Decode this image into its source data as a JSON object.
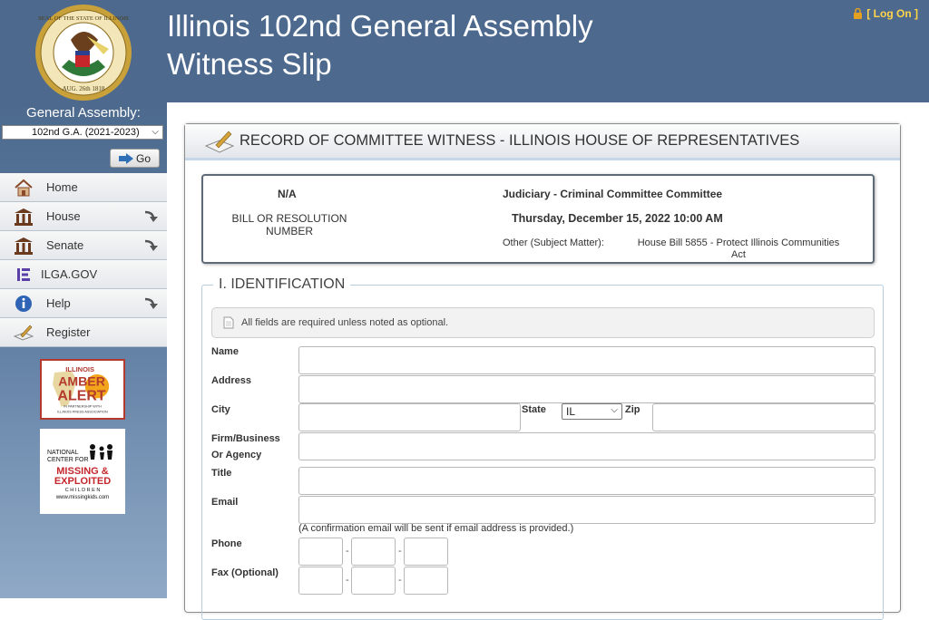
{
  "header": {
    "title_line1": "Illinois 102nd General Assembly",
    "title_line2": "Witness Slip",
    "logon": "[ Log On ]",
    "seal_text_top": "SEAL OF THE STATE OF ILLINOIS",
    "seal_text_bottom": "AUG. 26th 1818"
  },
  "sidebar": {
    "ga_label": "General Assembly:",
    "ga_selected": "102nd G.A. (2021-2023)",
    "go_label": "Go",
    "nav": [
      {
        "label": "Home",
        "icon": "house-icon"
      },
      {
        "label": "House",
        "icon": "capitol-icon"
      },
      {
        "label": "Senate",
        "icon": "capitol-icon"
      },
      {
        "label": "ILGA.GOV",
        "icon": "ilga-logo-icon"
      },
      {
        "label": "Help",
        "icon": "info-icon"
      },
      {
        "label": "Register",
        "icon": "pen-paper-icon"
      }
    ],
    "amber": {
      "line1": "ILLINOIS",
      "line2": "AMBER",
      "line3": "ALERT",
      "line4": "IN PARTNERSHIP WITH",
      "line5": "ILLINOIS PRESS ASSOCIATION"
    },
    "missing": {
      "line1": "NATIONAL",
      "line2": "CENTER FOR",
      "line3": "MISSING &",
      "line4": "EXPLOITED",
      "line5": "C H I L D R E N",
      "line6": "www.missingkids.com"
    }
  },
  "panel": {
    "title": "RECORD OF COMMITTEE WITNESS - ILLINOIS HOUSE OF REPRESENTATIVES",
    "bill_number": "N/A",
    "bill_label_1": "BILL OR RESOLUTION",
    "bill_label_2": "NUMBER",
    "committee": "Judiciary - Criminal Committee Committee",
    "datetime": "Thursday, December 15, 2022 10:00 AM",
    "other_label": "Other (Subject Matter):",
    "other_value_1": "House Bill 5855 - Protect Illinois Communities",
    "other_value_2": "Act"
  },
  "identification": {
    "legend": "I. IDENTIFICATION",
    "note": "All fields are required unless noted as optional.",
    "name_label": "Name",
    "address_label": "Address",
    "city_label": "City",
    "state_label": "State",
    "state_value": "IL",
    "zip_label": "Zip",
    "firm_label_1": "Firm/Business",
    "firm_label_2": "Or Agency",
    "title_label": "Title",
    "email_label": "Email",
    "email_note": "(A confirmation email will be sent if email address is provided.)",
    "phone_label": "Phone",
    "fax_label": "Fax (Optional)",
    "dash": "-"
  },
  "colors": {
    "header_bg": "#4d6a8e",
    "logon": "#ffd54a",
    "amber_red": "#b23a2e"
  }
}
